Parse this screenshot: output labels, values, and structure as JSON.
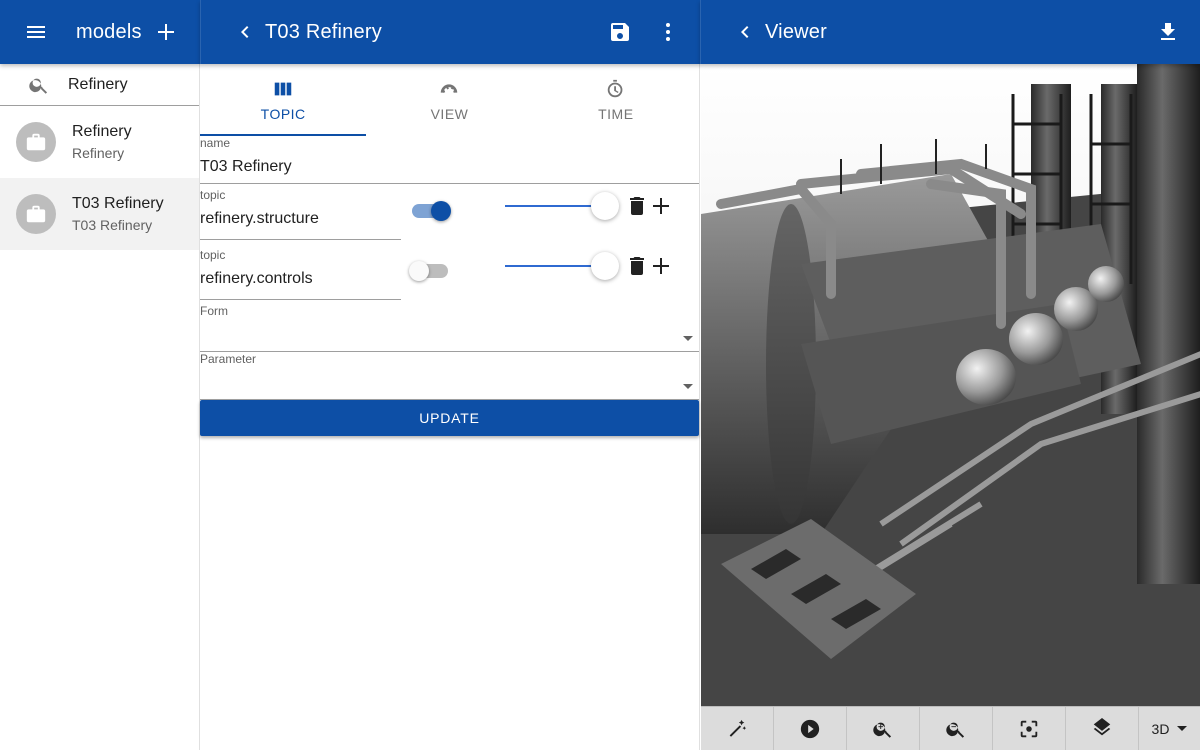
{
  "left_bar": {
    "title": "models"
  },
  "search": {
    "value": "Refinery",
    "placeholder": "Search"
  },
  "models": [
    {
      "name": "Refinery",
      "subtitle": "Refinery",
      "selected": false
    },
    {
      "name": "T03 Refinery",
      "subtitle": "T03 Refinery",
      "selected": true
    }
  ],
  "middle_bar": {
    "title": "T03 Refinery"
  },
  "tabs": [
    {
      "label": "TOPIC",
      "icon": "view-columns-icon",
      "active": true
    },
    {
      "label": "VIEW",
      "icon": "view-icon",
      "active": false
    },
    {
      "label": "TIME",
      "icon": "time-icon",
      "active": false
    }
  ],
  "form": {
    "name_label": "name",
    "name_value": "T03 Refinery",
    "topics": [
      {
        "label": "topic",
        "value": "refinery.structure",
        "enabled": true,
        "opacity": 1.0
      },
      {
        "label": "topic",
        "value": "refinery.controls",
        "enabled": false,
        "opacity": 1.0
      }
    ],
    "form_label": "Form",
    "form_value": "",
    "parameter_label": "Parameter",
    "parameter_value": "",
    "update_label": "UPDATE"
  },
  "right_bar": {
    "title": "Viewer"
  },
  "toolbar": {
    "tools": [
      "magic-wand-icon",
      "play-icon",
      "zoom-in-icon",
      "zoom-out-icon",
      "center-focus-icon",
      "layers-icon"
    ],
    "dimension": "3D"
  },
  "colors": {
    "primary": "#0d4fa6",
    "slider": "#2f6ad1",
    "switch_track_on": "#7ea3d4"
  }
}
